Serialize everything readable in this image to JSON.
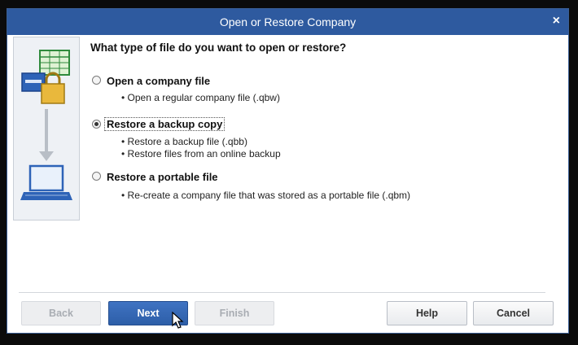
{
  "dialog": {
    "title": "Open or Restore Company",
    "close_label": "×"
  },
  "question": "What type of file do you want to open or restore?",
  "options": [
    {
      "label": "Open a company file",
      "selected": false,
      "bullets": [
        "• Open a regular company file (.qbw)"
      ]
    },
    {
      "label": "Restore a backup copy",
      "selected": true,
      "bullets": [
        "• Restore a backup file (.qbb)",
        "• Restore files from an online backup"
      ]
    },
    {
      "label": "Restore a portable file",
      "selected": false,
      "bullets": [
        "• Re-create a company file that was stored as a portable file (.qbm)"
      ]
    }
  ],
  "buttons": {
    "back": "Back",
    "next": "Next",
    "finish": "Finish",
    "help": "Help",
    "cancel": "Cancel"
  },
  "colors": {
    "title_bar": "#2e5a9f",
    "primary_button": "#3f73c2"
  },
  "icons": {
    "side_panel": [
      "spreadsheet-icon",
      "padlock-icon",
      "arrow-down-icon",
      "laptop-icon"
    ]
  }
}
